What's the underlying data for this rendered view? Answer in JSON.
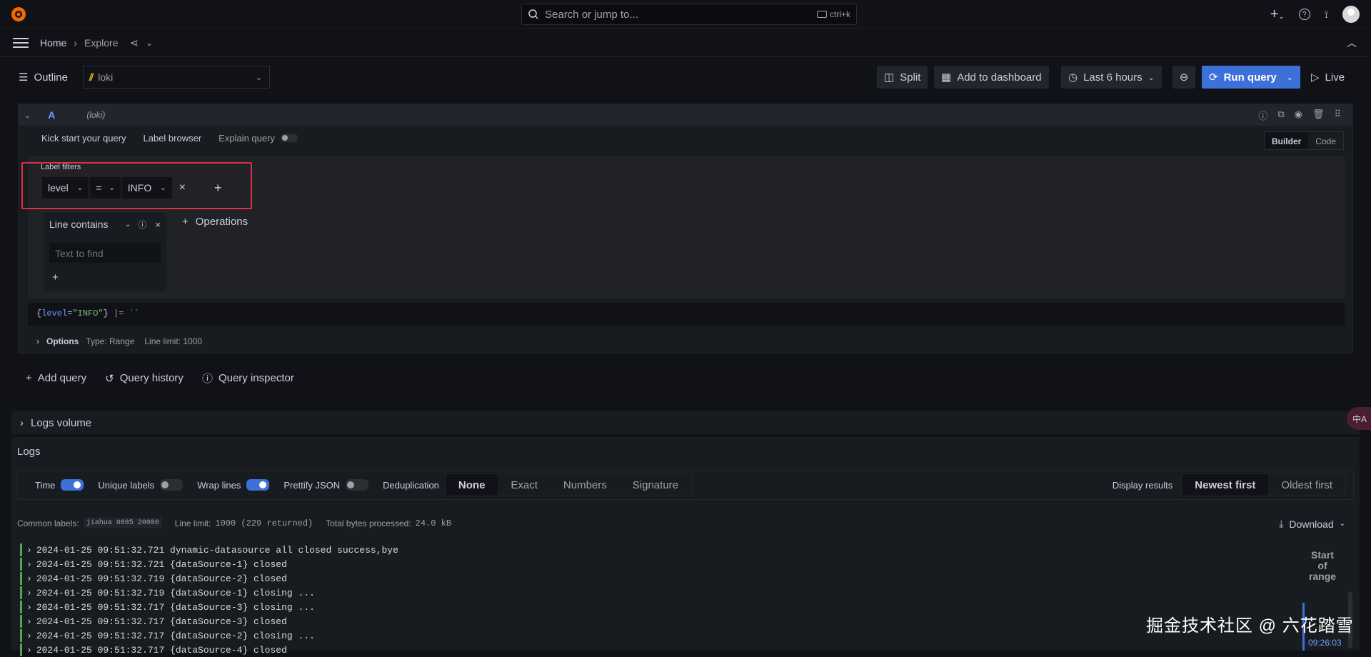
{
  "search": {
    "placeholder": "Search or jump to...",
    "shortcut": "ctrl+k"
  },
  "breadcrumb": {
    "home": "Home",
    "current": "Explore"
  },
  "toolbar": {
    "outline": "Outline",
    "datasource": "loki",
    "split": "Split",
    "add_to_dashboard": "Add to dashboard",
    "time_range": "Last 6 hours",
    "run_query": "Run query",
    "live": "Live"
  },
  "query": {
    "ref": "A",
    "datasource_label": "(loki)",
    "tabs": [
      "Kick start your query",
      "Label browser",
      "Explain query"
    ],
    "mode_builder": "Builder",
    "mode_code": "Code",
    "label_filters_title": "Label filters",
    "filter": {
      "label": "level",
      "operator": "=",
      "value": "INFO"
    },
    "operation": {
      "name": "Line contains",
      "placeholder": "Text to find"
    },
    "operations_btn": "Operations",
    "expression_parts": [
      "{",
      "level",
      "=",
      "\"INFO\"",
      "}",
      " |= ",
      "``"
    ],
    "options_label": "Options",
    "options_type": "Type: Range",
    "options_limit": "Line limit: 1000"
  },
  "actions": {
    "add_query": "Add query",
    "query_history": "Query history",
    "query_inspector": "Query inspector"
  },
  "logs_volume": "Logs volume",
  "logs": {
    "title": "Logs",
    "toggles": [
      {
        "label": "Time",
        "on": true
      },
      {
        "label": "Unique labels",
        "on": false
      },
      {
        "label": "Wrap lines",
        "on": true
      },
      {
        "label": "Prettify JSON",
        "on": false
      }
    ],
    "dedup_label": "Deduplication",
    "dedup_options": [
      "None",
      "Exact",
      "Numbers",
      "Signature"
    ],
    "dedup_selected": "None",
    "display_results_label": "Display results",
    "order_options": [
      "Newest first",
      "Oldest first"
    ],
    "order_selected": "Newest first",
    "common_labels_label": "Common labels:",
    "common_labels_value": "jiahua 8085 20000",
    "line_limit_label": "Line limit:",
    "line_limit_value": "1000 (229 returned)",
    "bytes_label": "Total bytes processed:",
    "bytes_value": "24.0 kB",
    "download": "Download",
    "lines": [
      "2024-01-25 09:51:32.721 dynamic-datasource all closed success,bye",
      "2024-01-25 09:51:32.721 {dataSource-1} closed",
      "2024-01-25 09:51:32.719 {dataSource-2} closed",
      "2024-01-25 09:51:32.719 {dataSource-1} closing ...",
      "2024-01-25 09:51:32.717 {dataSource-3} closing ...",
      "2024-01-25 09:51:32.717 {dataSource-3} closed",
      "2024-01-25 09:51:32.717 {dataSource-2} closing ...",
      "2024-01-25 09:51:32.717 {dataSource-4} closed"
    ],
    "range_start_line1": "Start",
    "range_start_line2": "of",
    "range_start_line3": "range",
    "range_time": "09:26:03"
  },
  "watermark": "掘金技术社区 @ 六花踏雪",
  "translate_icon_text": "中A"
}
